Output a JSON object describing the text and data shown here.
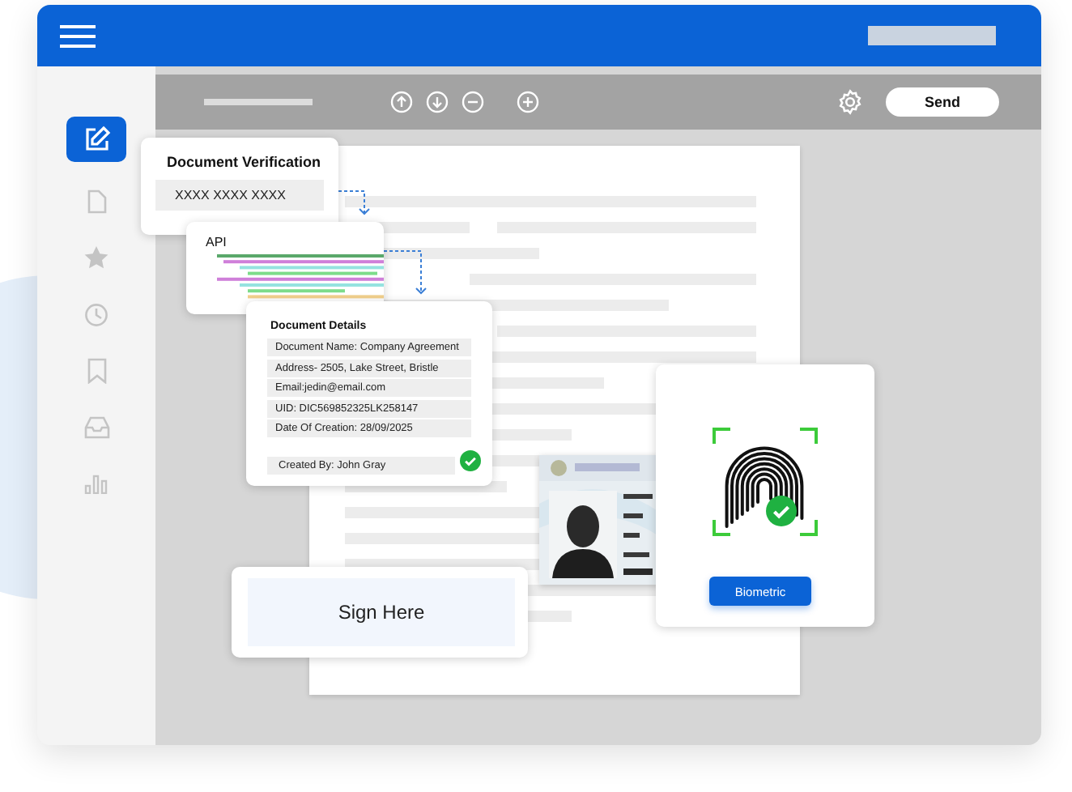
{
  "sidebar": {
    "items": [
      {
        "kind": "edit",
        "selected": true
      },
      {
        "kind": "file",
        "selected": false
      },
      {
        "kind": "star",
        "selected": false
      },
      {
        "kind": "clock",
        "selected": false
      },
      {
        "kind": "bookmark",
        "selected": false
      },
      {
        "kind": "inbox",
        "selected": false
      },
      {
        "kind": "chart",
        "selected": false
      }
    ]
  },
  "toolbar": {
    "send_button": "Send"
  },
  "verification_card": {
    "title": "Document Verification",
    "value": "XXXX XXXX XXXX"
  },
  "api_card": {
    "title": "API"
  },
  "details_card": {
    "title": "Document Details",
    "fields": [
      "Document Name: Company Agreement",
      "Address- 2505, Lake Street, Bristle",
      "Email:jedin@email.com",
      "UID: DIC569852325LK258147",
      "Date Of Creation: 28/09/2025"
    ],
    "footer": "Created By: John Gray",
    "verified": true
  },
  "biometric_card": {
    "button": "Biometric",
    "verified": true
  },
  "sign_card": {
    "label": "Sign Here"
  }
}
